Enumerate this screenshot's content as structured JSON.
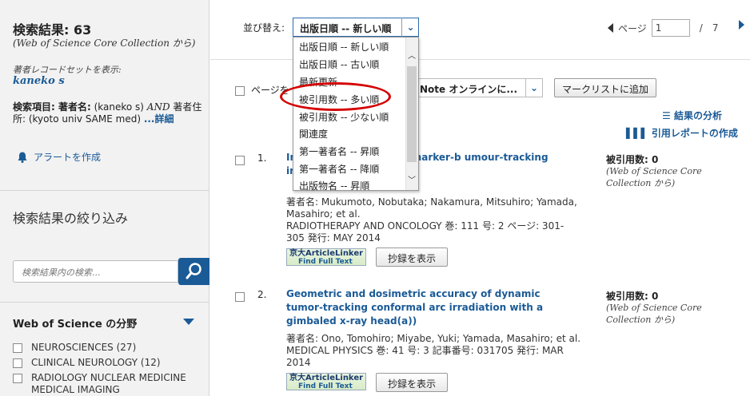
{
  "results": {
    "label": "検索結果: ",
    "count": "63",
    "source": "(Web of Science Core Collection から)"
  },
  "record_set": {
    "label": "著者レコードセットを表示:",
    "name": "kaneko s"
  },
  "query": {
    "label": "検索項目: 著者名:",
    "text1": " (kaneko s) ",
    "and": "AND",
    "text2": " 著者住所: (kyoto univ SAME med) ",
    "more": "...詳細"
  },
  "alert": "アラートを作成",
  "refine": {
    "title": "検索結果の絞り込み",
    "search_placeholder": "検索結果内の検索..."
  },
  "categories": {
    "title": "Web of Science の分野",
    "items": [
      "NEUROSCIENCES (27)",
      "CLINICAL NEUROLOGY (12)",
      "RADIOLOGY NUCLEAR MEDICINE MEDICAL IMAGING"
    ]
  },
  "sort": {
    "label": "並び替え:",
    "selected": "出版日順 -- 新しい順",
    "options": [
      "出版日順 -- 新しい順",
      "出版日順 -- 古い順",
      "最新更新",
      "被引用数 -- 多い順",
      "被引用数 -- 少ない順",
      "関連度",
      "第一著者名 -- 昇順",
      "第一著者名 -- 降順",
      "出版物名 -- 昇順"
    ]
  },
  "pager": {
    "label": "ページ",
    "current": "1",
    "sep": "/",
    "total": "7"
  },
  "toolbar": {
    "page_label": "ページを",
    "endnote": "Note オンラインに...",
    "mark": "マークリストに追加",
    "analysis": "結果の分析",
    "citation_report": "引用レポートの作成"
  },
  "records": [
    {
      "num": "1.",
      "title": "In  accuracy in infrared marker-b  umour-tracking irradiation w",
      "authors": "著者名: Mukumoto, Nobutaka; Nakamura, Mitsuhiro; Yamada, Masahiro; et al.",
      "source": "RADIOTHERAPY AND ONCOLOGY  巻: 111  号: 2  ページ: 301-305  発行: MAY 2014",
      "cited": "被引用数: 0",
      "cited_src": "(Web of Science Core Collection から)",
      "abstract": "抄録を表示",
      "linker_a": "京大ArticleLinker",
      "linker_b": "Find Full Text"
    },
    {
      "num": "2.",
      "title": "Geometric and dosimetric accuracy of dynamic tumor-tracking conformal arc irradiation with a gimbaled x-ray head(a))",
      "authors": "著者名: Ono, Tomohiro; Miyabe, Yuki; Yamada, Masahiro; et al.",
      "source": "MEDICAL PHYSICS  巻: 41  号: 3   記事番号: 031705  発行: MAR 2014",
      "cited": "被引用数: 0",
      "cited_src": "(Web of Science Core Collection から)",
      "abstract": "抄録を表示",
      "linker_a": "京大ArticleLinker",
      "linker_b": "Find Full Text"
    }
  ],
  "colors": {
    "accent": "#1a5a96",
    "highlight_circle": "#d40000",
    "sidebar_bg": "#f2f2f2"
  }
}
